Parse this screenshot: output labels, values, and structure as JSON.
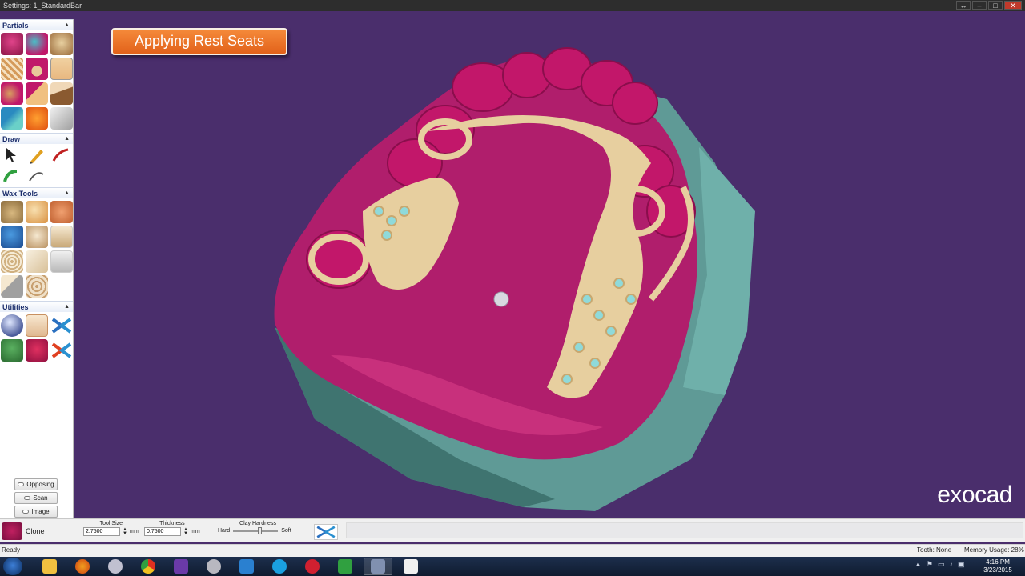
{
  "window": {
    "title": "Settings: 1_StandardBar"
  },
  "sidebar": {
    "sections": [
      {
        "title": "Partials"
      },
      {
        "title": "Draw"
      },
      {
        "title": "Wax Tools"
      },
      {
        "title": "Utilities"
      }
    ],
    "view_buttons": [
      "Opposing",
      "Scan",
      "Image"
    ]
  },
  "viewport": {
    "banner": "Applying Rest Seats",
    "brand": "exocad"
  },
  "toolbar": {
    "clone_label": "Clone",
    "tool_size": {
      "label": "Tool Size",
      "value": "2.7500",
      "unit": "mm"
    },
    "thickness": {
      "label": "Thickness",
      "value": "0.7500",
      "unit": "mm"
    },
    "clay_hardness": {
      "label": "Clay Hardness",
      "min_label": "Hard",
      "max_label": "Soft",
      "level": 0.55
    }
  },
  "statusbar": {
    "status": "Ready",
    "tooth": "Tooth: None",
    "memory": "Memory Usage: 28%"
  },
  "taskbar": {
    "time": "4:16 PM",
    "date": "3/23/2015"
  },
  "colors": {
    "background": "#4a2e6c",
    "gum": "#b01e6c",
    "metal": "#e7cf9f",
    "model_base": "#5f9a96",
    "banner": "#e8701f"
  }
}
